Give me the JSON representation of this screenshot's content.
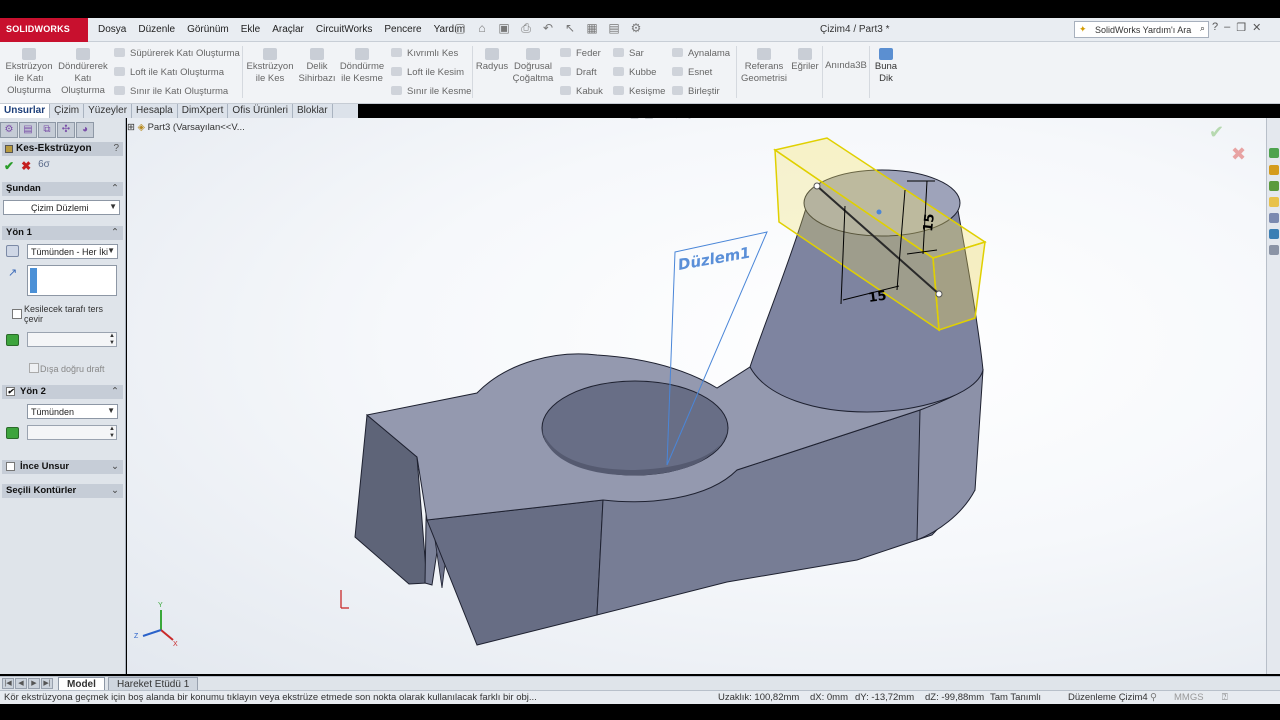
{
  "app": {
    "logo_text": "SOLIDWORKS",
    "document_title": "Çizim4 / Part3 *"
  },
  "menu": [
    "Dosya",
    "Düzenle",
    "Görünüm",
    "Ekle",
    "Araçlar",
    "CircuitWorks",
    "Pencere",
    "Yardım"
  ],
  "help_search": {
    "placeholder": "SolidWorks Yardım'ı Ara"
  },
  "ribbon": {
    "b1": "Ekstrüzyon ile Katı Oluşturma",
    "b2": "Döndürerek Katı Oluşturma",
    "r1": "Süpürerek Katı Oluşturma",
    "r2": "Loft ile Katı Oluşturma",
    "r3": "Sınır ile Katı Oluşturma",
    "b4": "Ekstrüzyon ile Kes",
    "b5": "Delik Sihirbazı",
    "b6": "Döndürme ile Kesme",
    "r4": "Kıvrımlı Kes",
    "r5": "Loft ile Kesim",
    "r6": "Sınır ile Kesme",
    "b7": "Radyus",
    "b8": "Doğrusal Çoğaltma",
    "r7": "Feder",
    "r8": "Draft",
    "r9": "Kabuk",
    "r10": "Sar",
    "r11": "Kubbe",
    "r12": "Kesişme",
    "r13": "Aynalama",
    "r14": "Esnet",
    "r15": "Birleştir",
    "b9": "Referans Geometrisi",
    "b10": "Eğriler",
    "b11": "Anında3B",
    "b12": "Buna Dik"
  },
  "tabs": [
    "Unsurlar",
    "Çizim",
    "Yüzeyler",
    "Hesapla",
    "DimXpert",
    "Ofis Ürünleri",
    "Bloklar"
  ],
  "property_manager": {
    "title": "Kes-Ekstrüzyon",
    "help": "?",
    "sundan": {
      "header": "Şundan",
      "value": "Çizim Düzlemi"
    },
    "yon1": {
      "header": "Yön 1",
      "end_condition": "Tümünden - Her İki",
      "flip_label": "Kesilecek tarafı ters çevir",
      "draft_label": "Dışa doğru draft"
    },
    "yon2": {
      "header": "Yön 2",
      "end_condition": "Tümünden"
    },
    "ince": {
      "header": "İnce Unsur"
    },
    "kontur": {
      "header": "Seçili Kontürler"
    }
  },
  "tree": {
    "root": "Part3  (Varsayılan<<V..."
  },
  "viewport": {
    "plane_label": "Düzlem1",
    "dim1": "15",
    "dim2": "15"
  },
  "triad": {
    "x": "X",
    "y": "Y",
    "z": "Z"
  },
  "bottom_tabs": [
    "Model",
    "Hareket Etüdü 1"
  ],
  "status": {
    "message": "Kör ekstrüzyona geçmek için boş alanda bir konumu tıklayın veya ekstrüze etmede son nokta olarak kullanılacak farklı bir obj...",
    "distance": "Uzaklık: 100,82mm",
    "dx": "dX: 0mm",
    "dy": "dY: -13,72mm",
    "dz": "dZ: -99,88mm",
    "defined": "Tam Tanımlı",
    "editing": "Düzenleme Çizim4",
    "units": "MMGS"
  }
}
